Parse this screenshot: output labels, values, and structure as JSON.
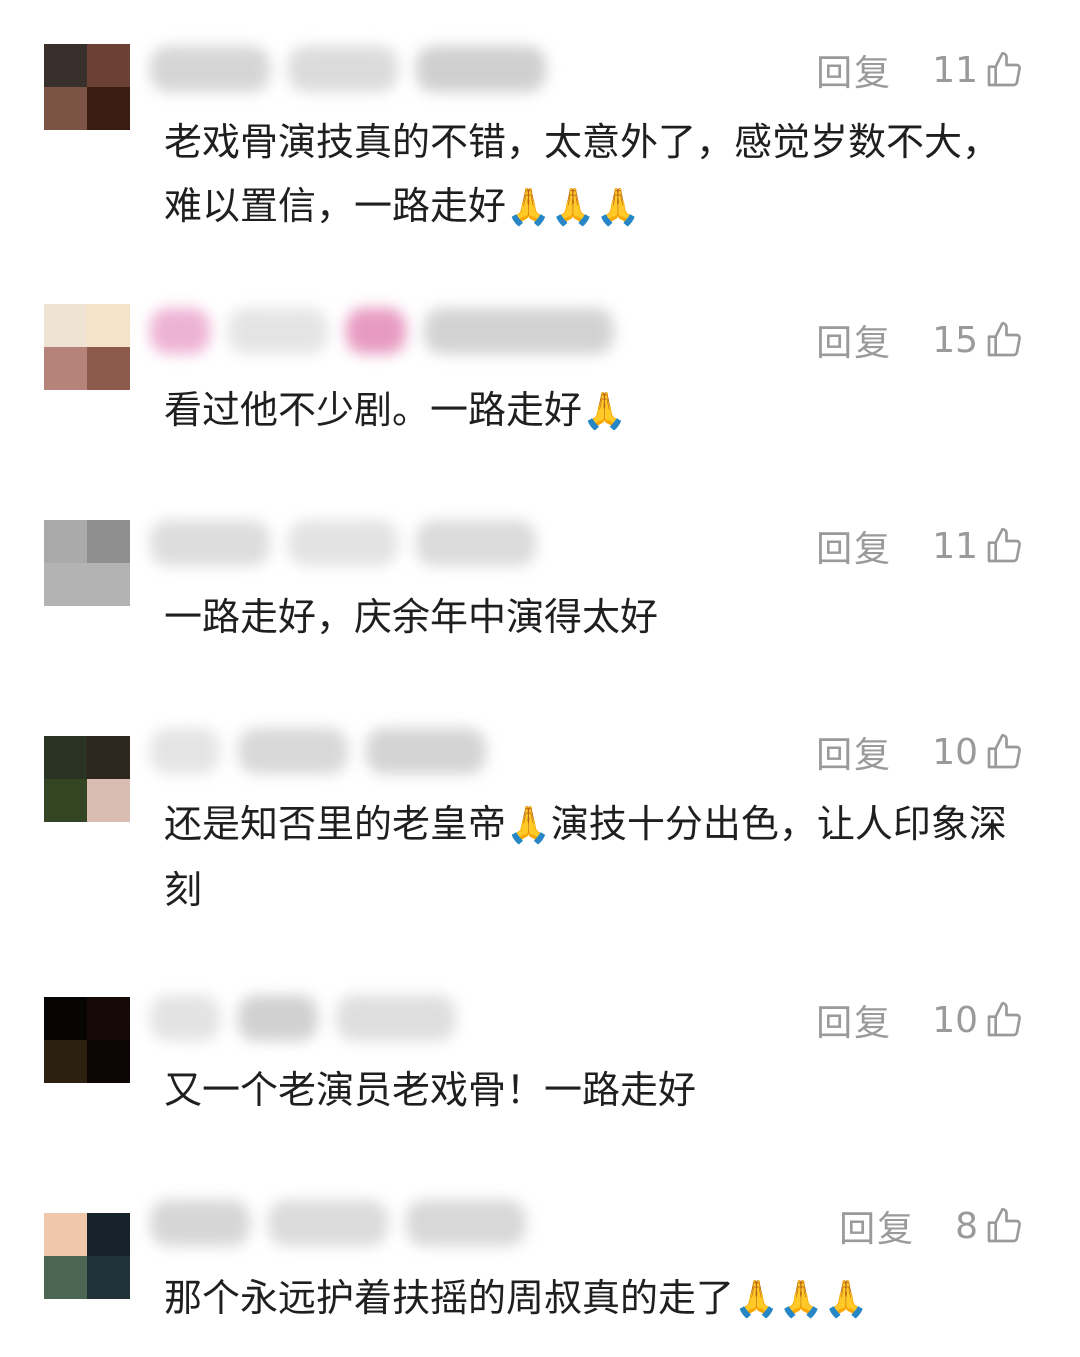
{
  "reply_label": "回复",
  "pray_emoji": "🙏",
  "comments": [
    {
      "avatar_colors": [
        "#3a302b",
        "#6b4136",
        "#7c5446",
        "#3a1c12"
      ],
      "likes": "11",
      "text": "老戏骨演技真的不错，太意外了，感觉岁数不大，难以置信，一路走好",
      "emoji": "🙏🙏🙏"
    },
    {
      "avatar_colors": [
        "#efe3d3",
        "#f7e3c8",
        "#b5837a",
        "#8d5b4c"
      ],
      "likes": "15",
      "text": "看过他不少剧。一路走好",
      "emoji": "🙏"
    },
    {
      "avatar_colors": [
        "#aaaaaa",
        "#8f8f8f",
        "#b3b3b3",
        "#b3b3b3"
      ],
      "likes": "11",
      "text": "一路走好，庆余年中演得太好",
      "emoji": ""
    },
    {
      "avatar_colors": [
        "#2a3324",
        "#2c261f",
        "#344523",
        "#d9bdb2"
      ],
      "likes": "10",
      "text_before": "还是知否里的老皇帝",
      "text_after": "演技十分出色，让人印象深刻",
      "emoji": "🙏"
    },
    {
      "avatar_colors": [
        "#070504",
        "#160a08",
        "#2c2010",
        "#0e0505"
      ],
      "likes": "10",
      "text": "又一个老演员老戏骨！一路走好",
      "emoji": ""
    },
    {
      "avatar_colors": [
        "#f1c7ab",
        "#16232b",
        "#4b6653",
        "#213239"
      ],
      "likes": "8",
      "text": "那个永远护着扶摇的周叔真的走了",
      "emoji": "🙏🙏🙏"
    }
  ]
}
